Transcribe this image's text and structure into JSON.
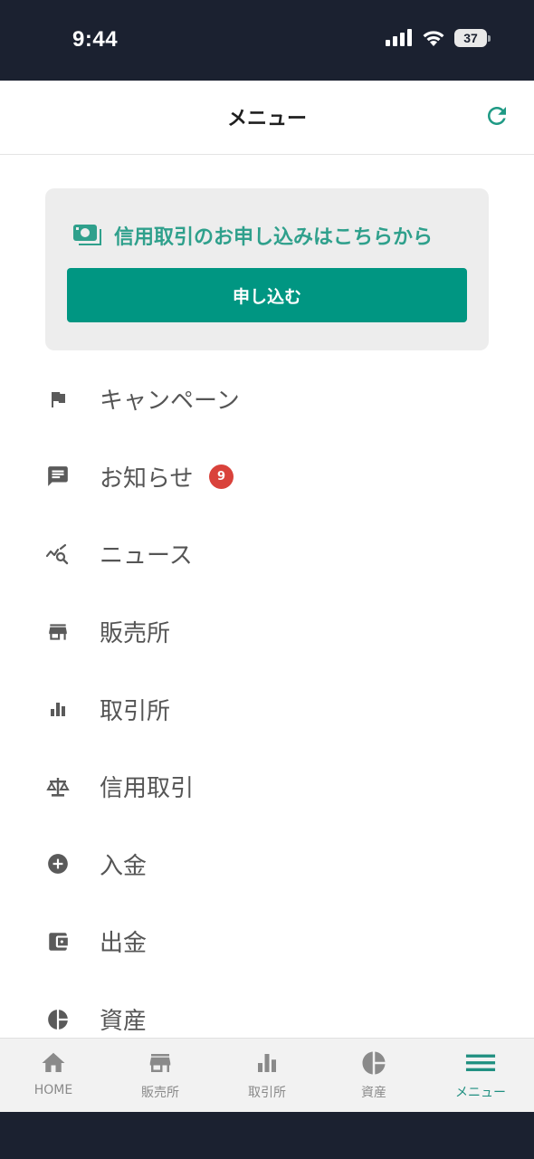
{
  "status_bar": {
    "time": "9:44",
    "battery": "37",
    "icons": [
      "signal-icon",
      "wifi-icon",
      "battery-icon"
    ]
  },
  "header": {
    "title": "メニュー",
    "refresh_icon": "refresh-icon"
  },
  "promo": {
    "text": "信用取引のお申し込みはこちらから",
    "button_label": "申し込む",
    "icon": "money-icon"
  },
  "menu": [
    {
      "id": "campaign",
      "label": "キャンペーン",
      "icon": "flag-icon"
    },
    {
      "id": "notices",
      "label": "お知らせ",
      "icon": "chat-icon",
      "badge": "9"
    },
    {
      "id": "news",
      "label": "ニュース",
      "icon": "news-chart-icon"
    },
    {
      "id": "store",
      "label": "販売所",
      "icon": "store-icon"
    },
    {
      "id": "exchange",
      "label": "取引所",
      "icon": "bar-chart-icon"
    },
    {
      "id": "margin",
      "label": "信用取引",
      "icon": "scale-icon"
    },
    {
      "id": "deposit",
      "label": "入金",
      "icon": "plus-circle-icon"
    },
    {
      "id": "withdraw",
      "label": "出金",
      "icon": "wallet-icon"
    },
    {
      "id": "assets",
      "label": "資産",
      "icon": "pie-chart-icon"
    }
  ],
  "bottom_nav": [
    {
      "id": "home",
      "label": "HOME",
      "icon": "home-icon"
    },
    {
      "id": "store",
      "label": "販売所",
      "icon": "store-icon"
    },
    {
      "id": "exchange",
      "label": "取引所",
      "icon": "bar-chart-icon"
    },
    {
      "id": "assets",
      "label": "資産",
      "icon": "pie-chart-icon"
    },
    {
      "id": "menu",
      "label": "メニュー",
      "icon": "menu-icon",
      "active": true
    }
  ],
  "colors": {
    "accent": "#009682",
    "accent_text": "#2fa08c",
    "badge": "#d9423b",
    "status_bar_bg": "#1b2130",
    "icon_gray": "#5a5a5a",
    "nav_inactive": "#8a8a8a"
  }
}
